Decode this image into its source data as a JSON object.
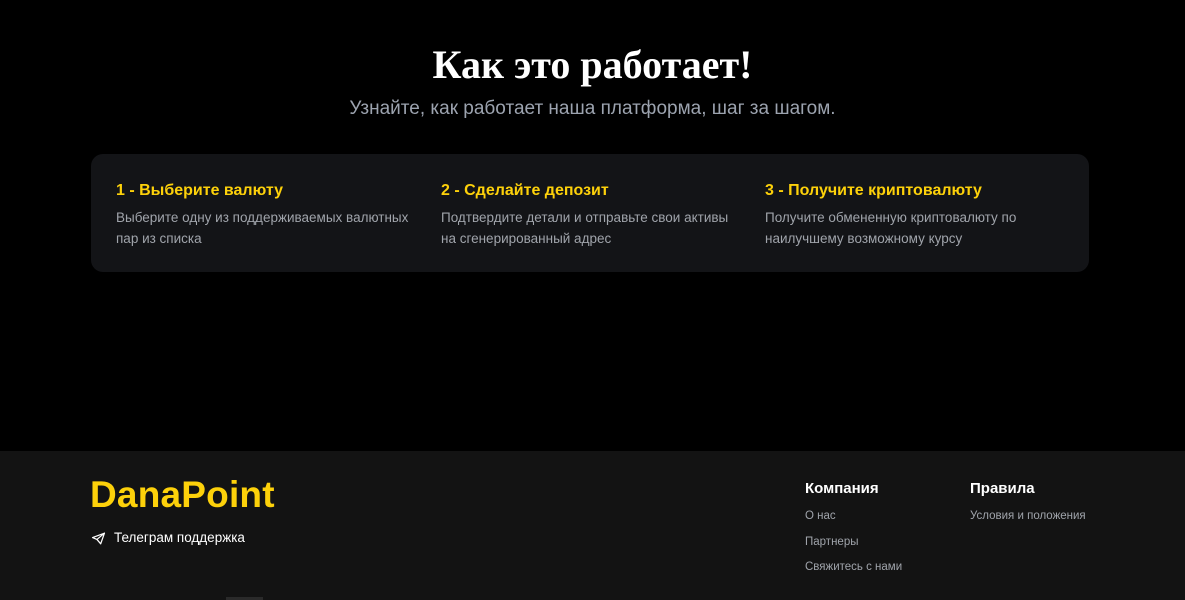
{
  "how_it_works": {
    "title": "Как это работает!",
    "subtitle": "Узнайте, как работает наша платформа, шаг за шагом.",
    "steps": [
      {
        "title": "1 - Выберите валюту",
        "description": "Выберите одну из поддерживаемых валютных пар из списка"
      },
      {
        "title": "2 - Сделайте депозит",
        "description": "Подтвердите детали и отправьте свои активы на сгенерированный адрес"
      },
      {
        "title": "3 - Получите криптовалюту",
        "description": "Получите обмененную криптовалюту по наилучшему возможному курсу"
      }
    ]
  },
  "footer": {
    "logo": "DanaPoint",
    "telegram": {
      "label": "Телеграм поддержка",
      "icon": "telegram-send-icon"
    },
    "columns": [
      {
        "title": "Компания",
        "links": [
          "О нас",
          "Партнеры",
          "Свяжитесь с нами"
        ]
      },
      {
        "title": "Правила",
        "links": [
          "Условия и положения"
        ]
      }
    ]
  },
  "colors": {
    "accent": "#fdd10a",
    "background": "#000000",
    "card": "#131417",
    "footer": "#131313",
    "muted_text": "#a0a4ab"
  }
}
